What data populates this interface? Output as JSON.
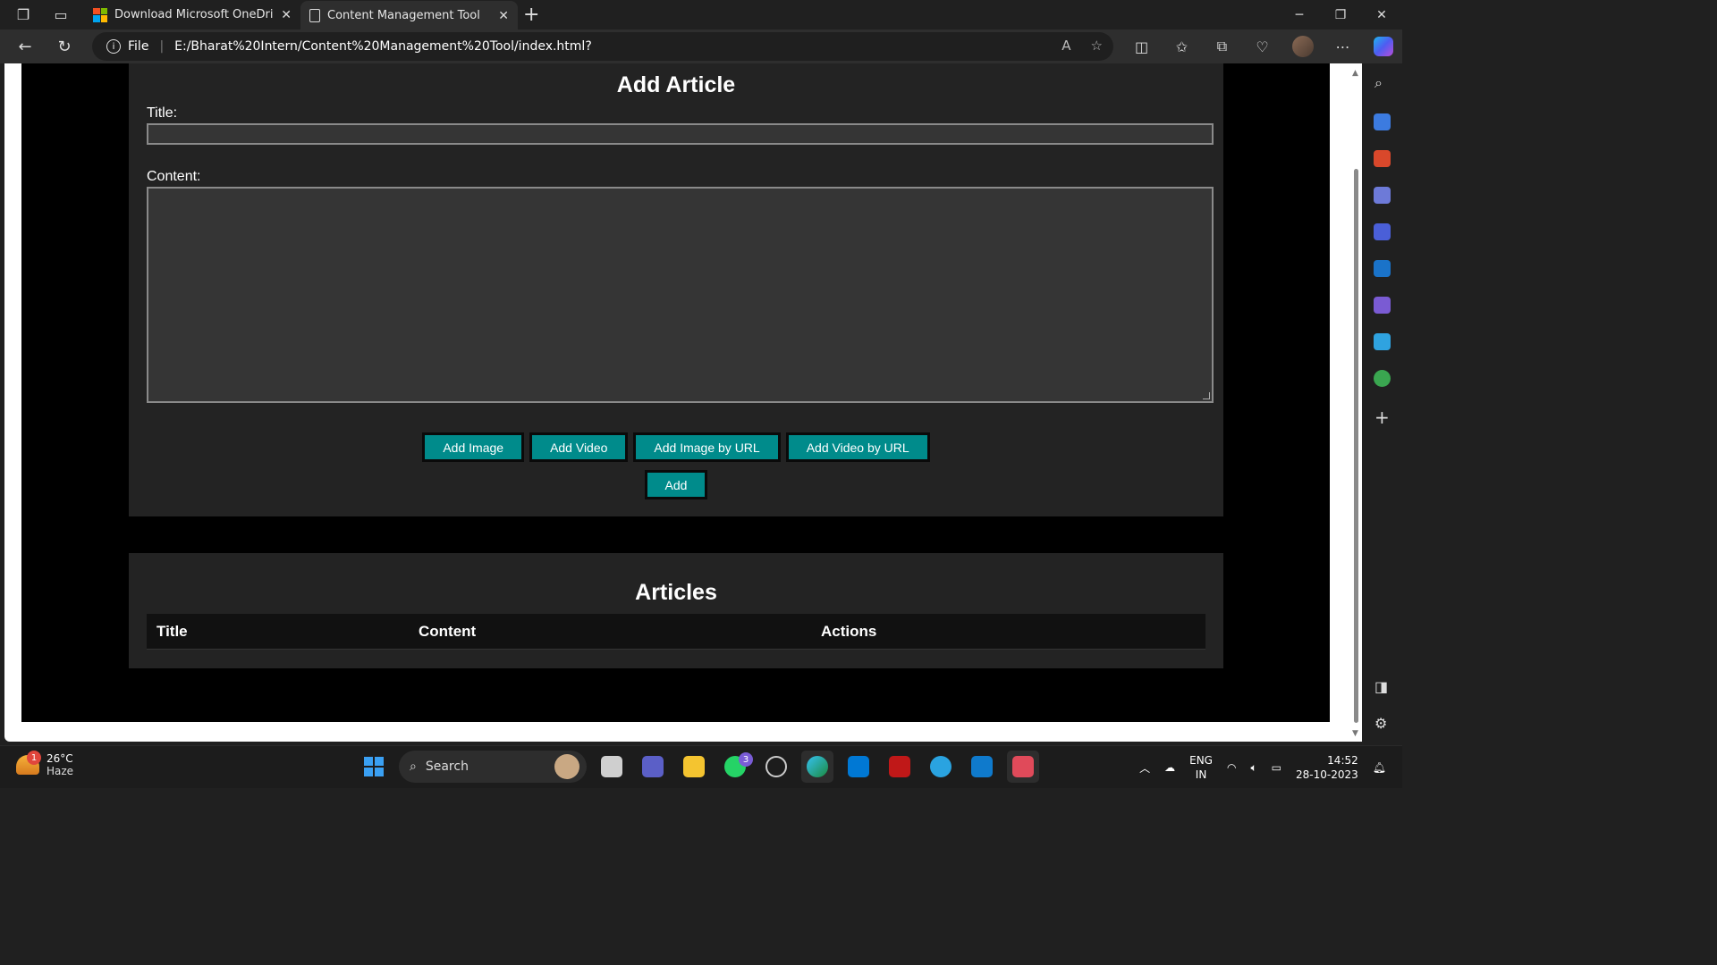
{
  "browser": {
    "tabs": [
      {
        "label": "Download Microsoft OneDrive M",
        "icon": "microsoft-logo-icon"
      },
      {
        "label": "Content Management Tool",
        "icon": "page-icon"
      }
    ],
    "address": {
      "scheme": "File",
      "url": "E:/Bharat%20Intern/Content%20Management%20Tool/index.html?"
    }
  },
  "page": {
    "add_article": {
      "heading": "Add Article",
      "title_label": "Title:",
      "title_value": "",
      "content_label": "Content:",
      "content_value": "",
      "buttons": {
        "add_image": "Add Image",
        "add_video": "Add Video",
        "add_image_url": "Add Image by URL",
        "add_video_url": "Add Video by URL",
        "add": "Add"
      }
    },
    "articles": {
      "heading": "Articles",
      "columns": [
        "Title",
        "Content",
        "Actions"
      ],
      "rows": []
    }
  },
  "taskbar": {
    "weather": {
      "temp": "26°C",
      "condition": "Haze",
      "badge": "1"
    },
    "search_label": "Search",
    "whatsapp_badge": "3",
    "lang": {
      "line1": "ENG",
      "line2": "IN"
    },
    "clock": {
      "time": "14:52",
      "date": "28-10-2023"
    }
  },
  "colors": {
    "accent_button": "#008b8b",
    "card_bg": "#232323",
    "page_bg": "#000000"
  }
}
